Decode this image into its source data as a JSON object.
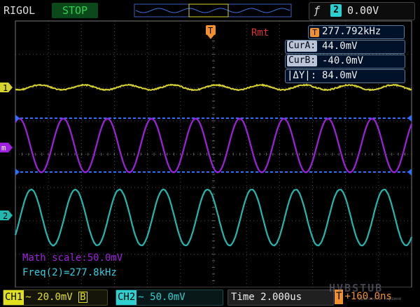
{
  "header": {
    "brand": "RIGOL",
    "run_status": "STOP",
    "trigger": {
      "edge_symbol": "ƒ",
      "channel": "2",
      "level": "0.00V"
    },
    "trigger_marker": "T"
  },
  "readouts": {
    "rmt": "Rmt",
    "frequency": "277.792kHz",
    "cur_a_label": "CurA:",
    "cur_a_value": "44.0mV",
    "cur_b_label": "CurB:",
    "cur_b_value": "-40.0mV",
    "delta_y_label": "|ΔY|:",
    "delta_y_value": "84.0mV"
  },
  "markers": {
    "ch1": "1",
    "math": "m",
    "ch2": "2"
  },
  "math": {
    "scale_text": "Math scale:50.0mV",
    "freq_text": "Freq(2)=277.8kHz"
  },
  "status": {
    "ch1_chip": "CH1",
    "ch1_text": "~ 20.0mV",
    "ch1_bw": "B",
    "ch2_chip": "CH2",
    "ch2_text": "~ 50.0mV",
    "time_text": "Time 2.000us",
    "trig_chip": "T",
    "trig_pos": "+160.0ns"
  },
  "watermark": "HVBSTUB",
  "watermark_sub": "Сделано в Украине",
  "colors": {
    "ch1": "#d8d22e",
    "math": "#a020e0",
    "ch2": "#22b8b0",
    "cursor": "#2f6fff",
    "trigger": "#f09030"
  }
}
